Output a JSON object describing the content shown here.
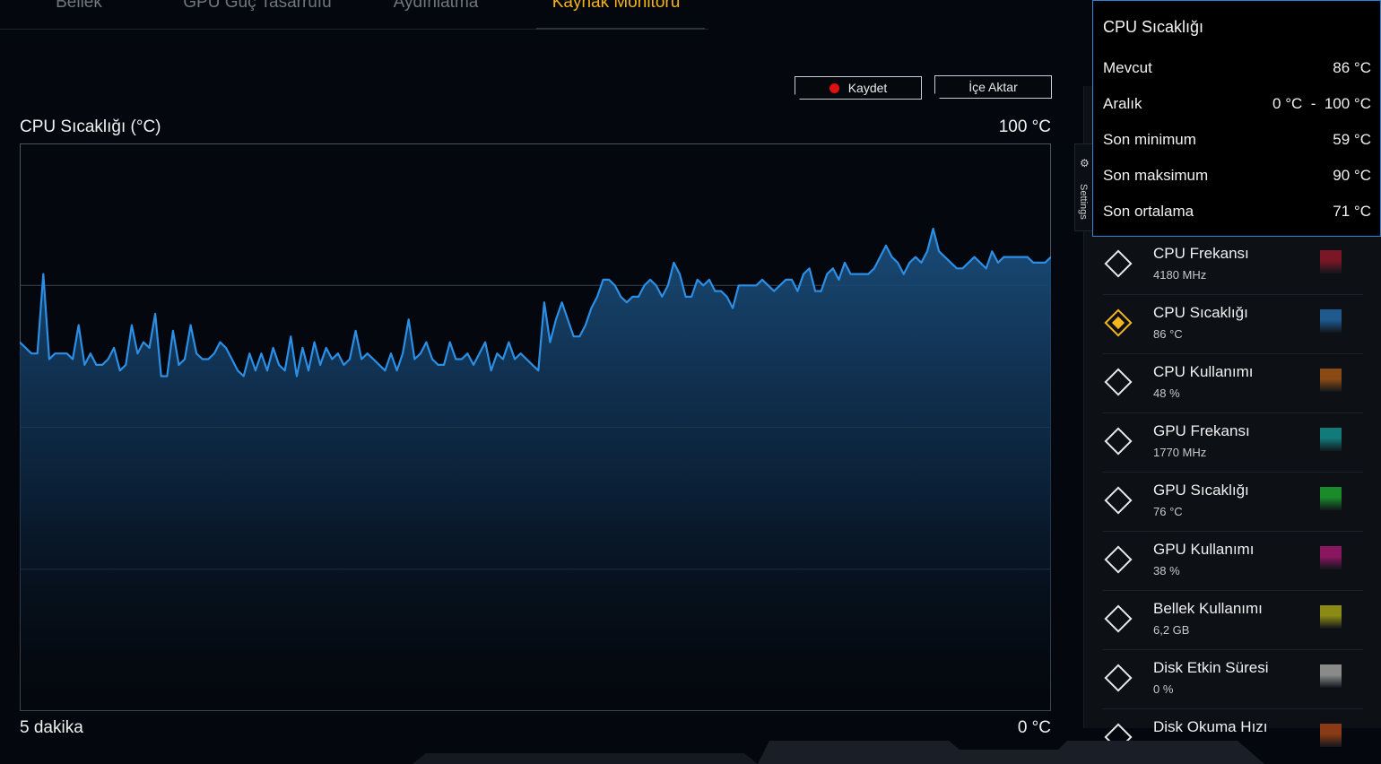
{
  "tabs": [
    {
      "label": "Bellek"
    },
    {
      "label": "GPU Güç Tasarrufu"
    },
    {
      "label": "Aydınlatma"
    },
    {
      "label": "Kaynak Monitörü"
    }
  ],
  "buttons": {
    "record": "Kaydet",
    "import": "İçe Aktar"
  },
  "chart": {
    "title": "CPU Sıcaklığı (°C)",
    "max_label": "100 °C",
    "min_label": "0 °C",
    "duration": "5 dakika"
  },
  "settings_tab": {
    "label": "Settings",
    "icon": "gear-icon"
  },
  "tooltip": {
    "title": "CPU Sıcaklığı",
    "rows": [
      {
        "key": "Mevcut",
        "value": "86 °C"
      },
      {
        "key": "Aralık",
        "value": "0 °C  -  100 °C"
      },
      {
        "key": "Son minimum",
        "value": "59 °C"
      },
      {
        "key": "Son maksimum",
        "value": "90 °C"
      },
      {
        "key": "Son ortalama",
        "value": "71 °C"
      }
    ]
  },
  "sensors": [
    {
      "name": "CPU Frekansı",
      "value": "4180 MHz",
      "color": "#7a1626",
      "selected": false
    },
    {
      "name": "CPU Sıcaklığı",
      "value": "86 °C",
      "color": "#1f5a8e",
      "selected": true
    },
    {
      "name": "CPU Kullanımı",
      "value": "48 %",
      "color": "#8a4a14",
      "selected": false
    },
    {
      "name": "GPU Frekansı",
      "value": "1770 MHz",
      "color": "#137a7a",
      "selected": false
    },
    {
      "name": "GPU Sıcaklığı",
      "value": "76 °C",
      "color": "#1a8a2a",
      "selected": false
    },
    {
      "name": "GPU Kullanımı",
      "value": "38 %",
      "color": "#8a1660",
      "selected": false
    },
    {
      "name": "Bellek Kullanımı",
      "value": "6,2 GB",
      "color": "#8a8a14",
      "selected": false
    },
    {
      "name": "Disk Etkin Süresi",
      "value": "0 %",
      "color": "#8a8a8a",
      "selected": false
    },
    {
      "name": "Disk Okuma Hızı",
      "value": "",
      "color": "#8a3a14",
      "selected": false
    }
  ],
  "colors": {
    "accent": "#f2b21b",
    "line": "#2b8fe6",
    "tooltip_border": "#2f86d6"
  },
  "chart_data": {
    "type": "area",
    "title": "CPU Sıcaklığı (°C)",
    "xlabel": "5 dakika",
    "ylabel": "",
    "ylim": [
      0,
      100
    ],
    "grid": true,
    "series": [
      {
        "values": [
          65,
          64,
          63,
          63,
          77,
          62,
          63,
          63,
          63,
          62,
          68,
          61,
          63,
          61,
          61,
          62,
          64,
          60,
          61,
          68,
          63,
          65,
          64,
          70,
          59,
          59,
          67,
          61,
          62,
          68,
          63,
          62,
          62,
          63,
          65,
          64,
          62,
          60,
          59,
          63,
          60,
          63,
          60,
          64,
          61,
          60,
          66,
          59,
          64,
          60,
          65,
          61,
          64,
          62,
          63,
          61,
          62,
          67,
          62,
          63,
          62,
          61,
          60,
          63,
          60,
          63,
          69,
          62,
          63,
          65,
          62,
          61,
          61,
          65,
          62,
          62,
          63,
          61,
          63,
          65,
          60,
          63,
          62,
          65,
          62,
          63,
          62,
          61,
          60,
          72,
          65,
          69,
          72,
          69,
          66,
          66,
          68,
          71,
          73,
          76,
          76,
          75,
          73,
          72,
          73,
          73,
          75,
          76,
          75,
          73,
          75,
          79,
          77,
          73,
          73,
          76,
          75,
          76,
          74,
          74,
          73,
          71,
          75,
          75,
          75,
          75,
          76,
          75,
          74,
          75,
          76,
          76,
          74,
          77,
          78,
          74,
          74,
          77,
          78,
          76,
          79,
          77,
          77,
          77,
          77,
          78,
          80,
          82,
          80,
          79,
          77,
          79,
          80,
          79,
          81,
          85,
          81,
          80,
          79,
          78,
          78,
          79,
          80,
          79,
          78,
          81,
          79,
          80,
          80,
          80,
          80,
          80,
          79,
          79,
          79,
          80
        ]
      }
    ]
  }
}
